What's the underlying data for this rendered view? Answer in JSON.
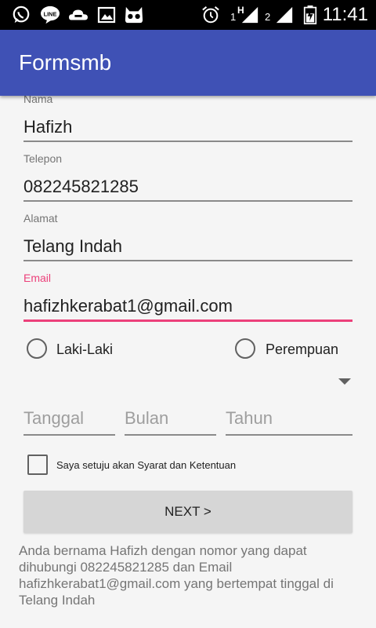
{
  "status_bar": {
    "time": "11:41",
    "icons": [
      "whatsapp-icon",
      "line-icon",
      "cloud-icon",
      "gallery-icon",
      "cyanogen-icon",
      "alarm-icon",
      "signal-sim1-icon",
      "signal-sim2-icon",
      "battery-icon"
    ],
    "sim1_label": "1",
    "sim1_network": "H",
    "sim2_label": "2"
  },
  "app_bar": {
    "title": "Formsmb",
    "color": "#3f51b5"
  },
  "form": {
    "nama": {
      "label": "Nama",
      "value": "Hafizh"
    },
    "telepon": {
      "label": "Telepon",
      "value": "082245821285"
    },
    "alamat": {
      "label": "Alamat",
      "value": "Telang Indah"
    },
    "email": {
      "label": "Email",
      "value": "hafizhkerabat1@gmail.com",
      "accent": "#ec407a"
    },
    "gender": {
      "option1": "Laki-Laki",
      "option2": "Perempuan"
    },
    "date": {
      "day_placeholder": "Tanggal",
      "month_placeholder": "Bulan",
      "year_placeholder": "Tahun"
    },
    "agree_label": "Saya setuju akan Syarat dan Ketentuan",
    "next_label": "NEXT >"
  },
  "summary_text": "Anda bernama Hafizh dengan nomor yang dapat dihubungi 082245821285 dan Email hafizhkerabat1@gmail.com yang bertempat tinggal di Telang Indah"
}
